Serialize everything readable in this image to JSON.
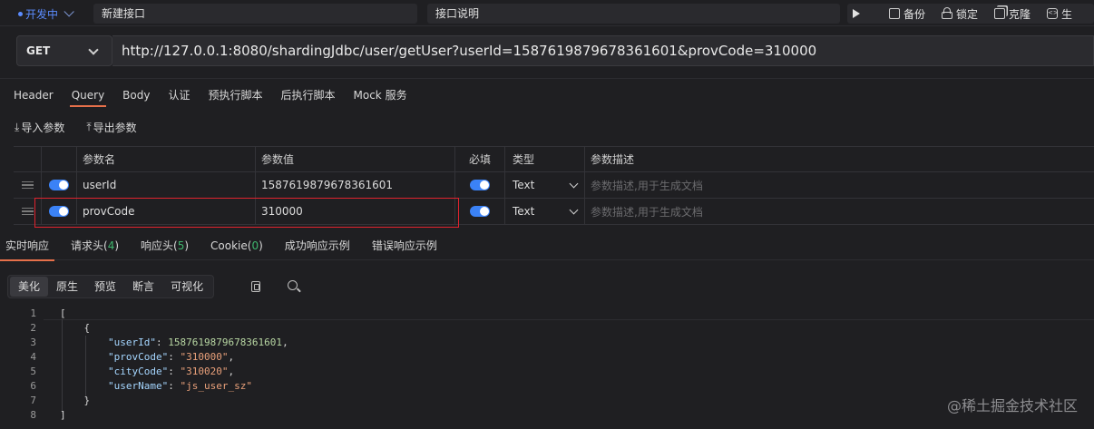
{
  "env": {
    "label": "开发中"
  },
  "api_name": "新建接口",
  "api_desc_label": "接口说明",
  "toolbar": {
    "backup": "备份",
    "lock": "锁定",
    "clone": "克隆",
    "generate": "生"
  },
  "request": {
    "method": "GET",
    "url": "http://127.0.0.1:8080/shardingJdbc/user/getUser?userId=1587619879678361601&provCode=310000"
  },
  "request_tabs": [
    "Header",
    "Query",
    "Body",
    "认证",
    "预执行脚本",
    "后执行脚本",
    "Mock 服务"
  ],
  "active_request_tab": "Query",
  "param_tools": {
    "import": "导入参数",
    "export": "导出参数"
  },
  "params_table": {
    "headers": {
      "name": "参数名",
      "value": "参数值",
      "required": "必填",
      "type": "类型",
      "desc": "参数描述"
    },
    "rows": [
      {
        "name": "userId",
        "value": "1587619879678361601",
        "type": "Text",
        "desc_placeholder": "参数描述,用于生成文档",
        "enabled": true,
        "required": true
      },
      {
        "name": "provCode",
        "value": "310000",
        "type": "Text",
        "desc_placeholder": "参数描述,用于生成文档",
        "enabled": true,
        "required": true
      }
    ]
  },
  "response_tabs": [
    {
      "label": "实时响应",
      "count": ""
    },
    {
      "label": "请求头(",
      "count": "4",
      "suffix": ")"
    },
    {
      "label": "响应头(",
      "count": "5",
      "suffix": ")"
    },
    {
      "label": "Cookie(",
      "count": "0",
      "suffix": ")"
    },
    {
      "label": "成功响应示例",
      "count": ""
    },
    {
      "label": "错误响应示例",
      "count": ""
    }
  ],
  "format_buttons": [
    "美化",
    "原生",
    "预览",
    "断言",
    "可视化"
  ],
  "response_body": {
    "userId": "1587619879678361601",
    "provCode": "\"310000\"",
    "cityCode": "\"310020\"",
    "userName": "\"js_user_sz\""
  },
  "watermark": "@稀土掘金技术社区",
  "colors": {
    "accent": "#e6704a",
    "toggle": "#3b82f6",
    "highlight": "#e0232e",
    "count": "#3fb66e"
  }
}
